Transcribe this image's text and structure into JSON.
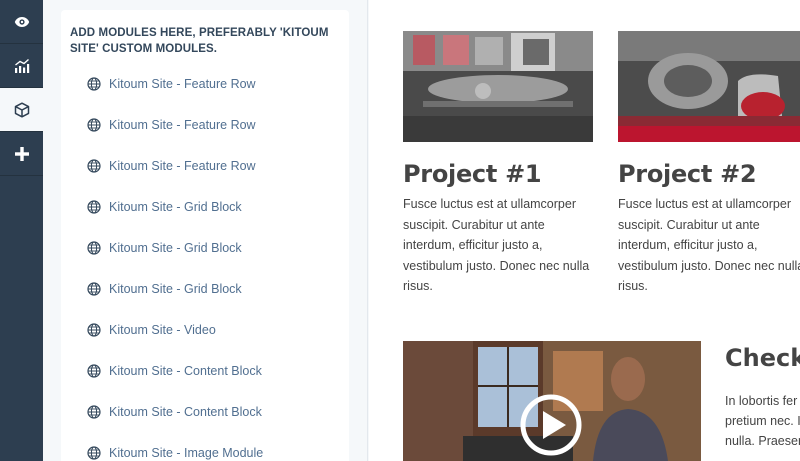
{
  "toolbar": {
    "items": [
      {
        "icon": "eye-icon"
      },
      {
        "icon": "analytics-icon"
      },
      {
        "icon": "cube-icon",
        "active": true
      },
      {
        "icon": "plus-icon"
      }
    ]
  },
  "panel": {
    "title": "ADD MODULES HERE, PREFERABLY 'KITOUM SITE' CUSTOM MODULES.",
    "modules": [
      "Kitoum Site - Feature Row",
      "Kitoum Site - Feature Row",
      "Kitoum Site - Feature Row",
      "Kitoum Site - Grid Block",
      "Kitoum Site - Grid Block",
      "Kitoum Site - Grid Block",
      "Kitoum Site - Video",
      "Kitoum Site - Content Block",
      "Kitoum Site - Content Block",
      "Kitoum Site - Image Module"
    ]
  },
  "preview": {
    "projects": [
      {
        "title": "Project #1",
        "body": "Fusce luctus est at ullamcorper suscipit. Curabitur ut ante interdum, efficitur justo a, vestibulum justo. Donec nec nulla risus."
      },
      {
        "title": "Project #2",
        "body": "Fusce luctus est at ullamcorper suscipit. Curabitur ut ante interdum, efficitur justo a, vestibulum justo. Donec nec nulla risus."
      }
    ],
    "check_title": "Check y",
    "check_body": [
      "In lobortis fer",
      "pretium nec. I",
      "nulla. Praesen"
    ]
  },
  "colors": {
    "toolbar_bg": "#2d3e50",
    "text_dark": "#444444",
    "accent_red": "#c8102e"
  }
}
